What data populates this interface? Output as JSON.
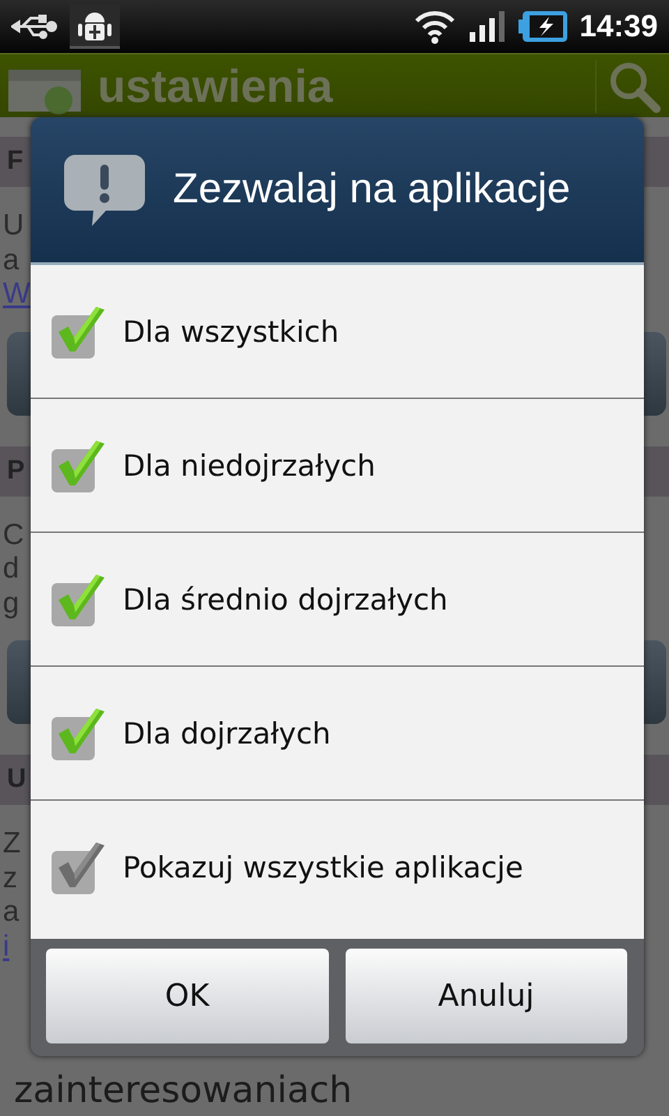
{
  "status_bar": {
    "time": "14:39"
  },
  "action_bar": {
    "title": "ustawienia"
  },
  "background": [
    {
      "kind": "header",
      "text": "F"
    },
    {
      "kind": "line",
      "text": "U"
    },
    {
      "kind": "line",
      "text": "a"
    },
    {
      "kind": "link",
      "text": "W"
    },
    {
      "kind": "button"
    },
    {
      "kind": "header",
      "text": "P"
    },
    {
      "kind": "line",
      "text": "C"
    },
    {
      "kind": "line",
      "text": "d"
    },
    {
      "kind": "line",
      "text": "g"
    },
    {
      "kind": "button"
    },
    {
      "kind": "header",
      "text": "U"
    },
    {
      "kind": "line",
      "text": "Z"
    },
    {
      "kind": "line",
      "text": "z"
    },
    {
      "kind": "line",
      "text": "a"
    },
    {
      "kind": "link",
      "text": "i"
    },
    {
      "kind": "spacer"
    },
    {
      "kind": "large",
      "text": "zainteresowaniach"
    }
  ],
  "dialog": {
    "title": "Zezwalaj na aplikacje",
    "options": [
      {
        "label": "Dla wszystkich",
        "checked": true,
        "disabled": false
      },
      {
        "label": "Dla niedojrzałych",
        "checked": true,
        "disabled": false
      },
      {
        "label": "Dla średnio dojrzałych",
        "checked": true,
        "disabled": false
      },
      {
        "label": "Dla dojrzałych",
        "checked": true,
        "disabled": false
      },
      {
        "label": "Pokazuj wszystkie aplikacje",
        "checked": true,
        "disabled": true
      }
    ],
    "buttons": [
      "OK",
      "Anuluj"
    ]
  }
}
